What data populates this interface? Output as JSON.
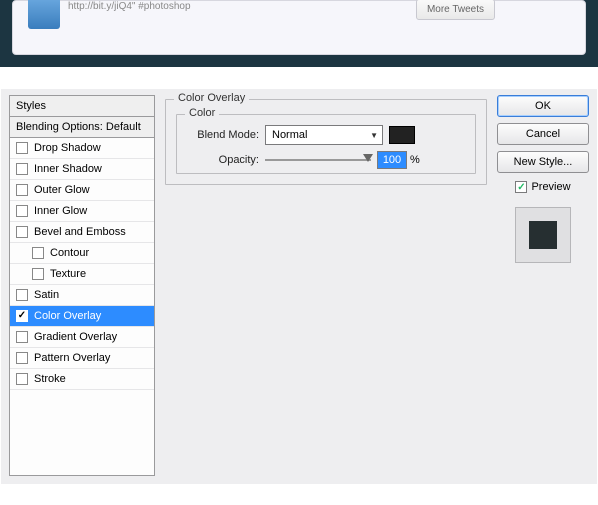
{
  "top": {
    "bitly_text": "http://bit.y/jiQ4\" #photoshop",
    "more_tweets": "More Tweets"
  },
  "dialog": {
    "styles_header": "Styles",
    "blending_header": "Blending Options: Default",
    "style_items": [
      {
        "label": "Drop Shadow",
        "checked": false,
        "indent": false,
        "selected": false
      },
      {
        "label": "Inner Shadow",
        "checked": false,
        "indent": false,
        "selected": false
      },
      {
        "label": "Outer Glow",
        "checked": false,
        "indent": false,
        "selected": false
      },
      {
        "label": "Inner Glow",
        "checked": false,
        "indent": false,
        "selected": false
      },
      {
        "label": "Bevel and Emboss",
        "checked": false,
        "indent": false,
        "selected": false
      },
      {
        "label": "Contour",
        "checked": false,
        "indent": true,
        "selected": false
      },
      {
        "label": "Texture",
        "checked": false,
        "indent": true,
        "selected": false
      },
      {
        "label": "Satin",
        "checked": false,
        "indent": false,
        "selected": false
      },
      {
        "label": "Color Overlay",
        "checked": true,
        "indent": false,
        "selected": true
      },
      {
        "label": "Gradient Overlay",
        "checked": false,
        "indent": false,
        "selected": false
      },
      {
        "label": "Pattern Overlay",
        "checked": false,
        "indent": false,
        "selected": false
      },
      {
        "label": "Stroke",
        "checked": false,
        "indent": false,
        "selected": false
      }
    ],
    "panel_title": "Color Overlay",
    "group_title": "Color",
    "blend_mode_label": "Blend Mode:",
    "blend_mode_value": "Normal",
    "color_swatch": "#222222",
    "opacity_label": "Opacity:",
    "opacity_value": "100",
    "opacity_unit": "%",
    "buttons": {
      "ok": "OK",
      "cancel": "Cancel",
      "new_style": "New Style..."
    },
    "preview_label": "Preview",
    "preview_checked": true,
    "preview_color": "#262f31"
  }
}
